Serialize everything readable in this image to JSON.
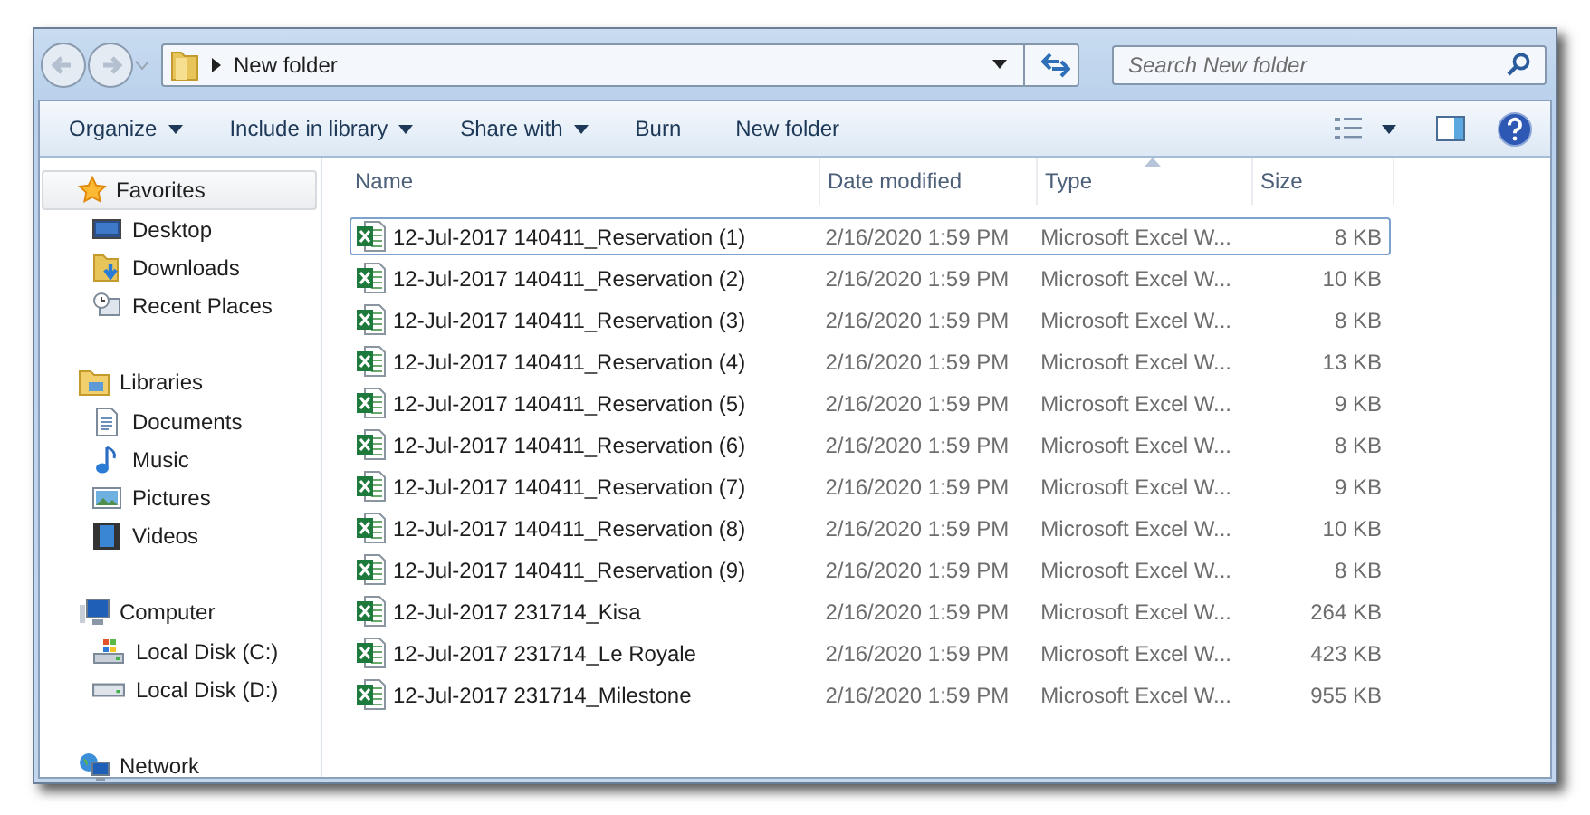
{
  "address_bar": {
    "breadcrumb": "New folder"
  },
  "search": {
    "placeholder": "Search New folder"
  },
  "toolbar": {
    "buttons": [
      {
        "label": "Organize",
        "dropdown": true
      },
      {
        "label": "Include in library",
        "dropdown": true
      },
      {
        "label": "Share with",
        "dropdown": true
      },
      {
        "label": "Burn",
        "dropdown": false
      },
      {
        "label": "New folder",
        "dropdown": false
      }
    ]
  },
  "sidebar": {
    "groups": [
      {
        "label": "Favorites",
        "selected": true,
        "children": [
          {
            "label": "Desktop"
          },
          {
            "label": "Downloads"
          },
          {
            "label": "Recent Places"
          }
        ]
      },
      {
        "label": "Libraries",
        "selected": false,
        "children": [
          {
            "label": "Documents"
          },
          {
            "label": "Music"
          },
          {
            "label": "Pictures"
          },
          {
            "label": "Videos"
          }
        ]
      },
      {
        "label": "Computer",
        "selected": false,
        "children": [
          {
            "label": "Local Disk (C:)"
          },
          {
            "label": "Local Disk (D:)"
          }
        ]
      },
      {
        "label": "Network",
        "selected": false
      }
    ]
  },
  "table": {
    "columns": [
      {
        "label": "Name",
        "sorted": false
      },
      {
        "label": "Date modified",
        "sorted": false
      },
      {
        "label": "Type",
        "sorted": true
      },
      {
        "label": "Size",
        "sorted": false
      }
    ],
    "rows": [
      {
        "name": "12-Jul-2017 140411_Reservation (1)",
        "date": "2/16/2020 1:59 PM",
        "type": "Microsoft Excel W...",
        "size": "8 KB",
        "focused": true
      },
      {
        "name": "12-Jul-2017 140411_Reservation (2)",
        "date": "2/16/2020 1:59 PM",
        "type": "Microsoft Excel W...",
        "size": "10 KB",
        "focused": false
      },
      {
        "name": "12-Jul-2017 140411_Reservation (3)",
        "date": "2/16/2020 1:59 PM",
        "type": "Microsoft Excel W...",
        "size": "8 KB",
        "focused": false
      },
      {
        "name": "12-Jul-2017 140411_Reservation (4)",
        "date": "2/16/2020 1:59 PM",
        "type": "Microsoft Excel W...",
        "size": "13 KB",
        "focused": false
      },
      {
        "name": "12-Jul-2017 140411_Reservation (5)",
        "date": "2/16/2020 1:59 PM",
        "type": "Microsoft Excel W...",
        "size": "9 KB",
        "focused": false
      },
      {
        "name": "12-Jul-2017 140411_Reservation (6)",
        "date": "2/16/2020 1:59 PM",
        "type": "Microsoft Excel W...",
        "size": "8 KB",
        "focused": false
      },
      {
        "name": "12-Jul-2017 140411_Reservation (7)",
        "date": "2/16/2020 1:59 PM",
        "type": "Microsoft Excel W...",
        "size": "9 KB",
        "focused": false
      },
      {
        "name": "12-Jul-2017 140411_Reservation (8)",
        "date": "2/16/2020 1:59 PM",
        "type": "Microsoft Excel W...",
        "size": "10 KB",
        "focused": false
      },
      {
        "name": "12-Jul-2017 140411_Reservation (9)",
        "date": "2/16/2020 1:59 PM",
        "type": "Microsoft Excel W...",
        "size": "8 KB",
        "focused": false
      },
      {
        "name": "12-Jul-2017 231714_Kisa",
        "date": "2/16/2020 1:59 PM",
        "type": "Microsoft Excel W...",
        "size": "264 KB",
        "focused": false
      },
      {
        "name": "12-Jul-2017 231714_Le Royale",
        "date": "2/16/2020 1:59 PM",
        "type": "Microsoft Excel W...",
        "size": "423 KB",
        "focused": false
      },
      {
        "name": "12-Jul-2017 231714_Milestone",
        "date": "2/16/2020 1:59 PM",
        "type": "Microsoft Excel W...",
        "size": "955 KB",
        "focused": false
      }
    ]
  }
}
